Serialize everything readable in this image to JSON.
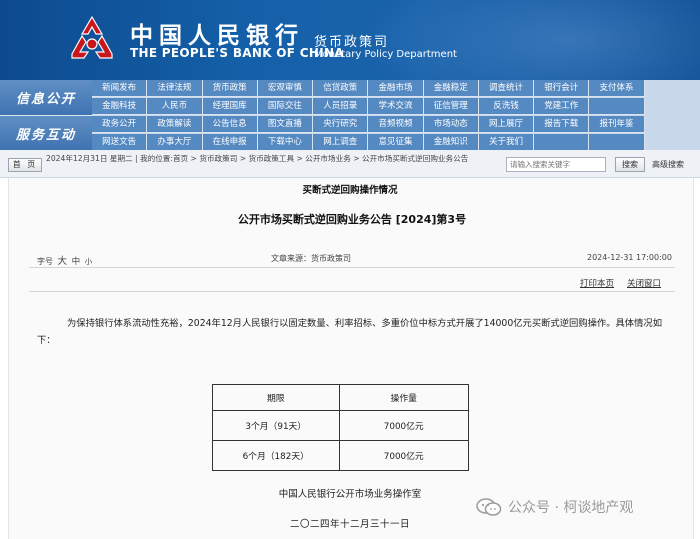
{
  "header": {
    "bank_cn": "中国人民银行",
    "bank_en": "THE PEOPLE'S BANK OF CHINA",
    "dept_cn": "货币政策司",
    "dept_en": "Monetary Policy Department",
    "logo_icon": "pboc-logo-icon",
    "brand_color": "#1460a8",
    "logo_color": "#c8161d"
  },
  "nav": {
    "block1": "信息公开",
    "block2": "服务互动",
    "rows": [
      [
        "新闻发布",
        "法律法规",
        "货币政策",
        "宏观审慎",
        "信贷政策",
        "金融市场",
        "金融稳定",
        "调查统计",
        "银行会计",
        "支付体系"
      ],
      [
        "金融科技",
        "人民币",
        "经理国库",
        "国际交往",
        "人员招录",
        "学术交流",
        "征信管理",
        "反洗钱",
        "党建工作",
        ""
      ],
      [
        "政务公开",
        "政策解读",
        "公告信息",
        "图文直播",
        "央行研究",
        "音频视频",
        "市场动态",
        "网上展厅",
        "报告下载",
        "报刊年鉴"
      ],
      [
        "网送文告",
        "办事大厅",
        "在线申报",
        "下载中心",
        "网上调查",
        "意见征集",
        "金融知识",
        "关于我们",
        "",
        ""
      ]
    ]
  },
  "crumb": {
    "home": "首 页",
    "text": "2024年12月31日 星期二 | 我的位置:首页 > 货币政策司 > 货币政策工具 > 公开市场业务 > 公开市场买断式逆回购业务公告",
    "search_placeholder": "请输入搜索关键字",
    "search_button": "搜索",
    "advanced_search": "高级搜索"
  },
  "article": {
    "title": "公开市场买断式逆回购业务公告 [2024]第3号",
    "font_label": "字号",
    "font_sizes": [
      "大",
      "中",
      "小"
    ],
    "source": "文章来源：货币政策司",
    "datetime": "2024-12-31 17:00:00",
    "print_label": "打印本页",
    "close_label": "关闭窗口",
    "paragraph": "为保持银行体系流动性充裕，2024年12月人民银行以固定数量、利率招标、多重价位中标方式开展了14000亿元买断式逆回购操作。具体情况如下：",
    "table_caption": "买断式逆回购操作情况",
    "table": {
      "headers": [
        "期限",
        "操作量"
      ],
      "rows": [
        [
          "3个月（91天）",
          "7000亿元"
        ],
        [
          "6个月（182天）",
          "7000亿元"
        ]
      ]
    },
    "signature": "中国人民银行公开市场业务操作室",
    "date_cn": "二〇二四年十二月三十一日"
  },
  "watermark": {
    "icon": "wechat-icon",
    "text": "公众号 · 柯谈地产观"
  }
}
